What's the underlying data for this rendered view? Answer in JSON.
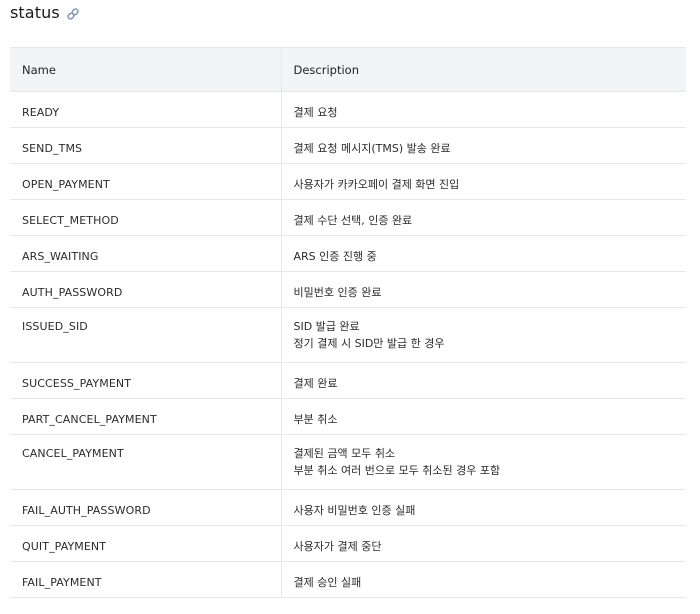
{
  "heading": {
    "title": "status"
  },
  "table": {
    "columns": [
      "Name",
      "Description"
    ],
    "rows": [
      {
        "name": "READY",
        "description": [
          "결제 요청"
        ]
      },
      {
        "name": "SEND_TMS",
        "description": [
          "결제 요청 메시지(TMS) 발송 완료"
        ]
      },
      {
        "name": "OPEN_PAYMENT",
        "description": [
          "사용자가 카카오페이 결제 화면 진입"
        ]
      },
      {
        "name": "SELECT_METHOD",
        "description": [
          "결제 수단 선택, 인증 완료"
        ]
      },
      {
        "name": "ARS_WAITING",
        "description": [
          "ARS 인증 진행 중"
        ]
      },
      {
        "name": "AUTH_PASSWORD",
        "description": [
          "비밀번호 인증 완료"
        ]
      },
      {
        "name": "ISSUED_SID",
        "description": [
          "SID 발급 완료",
          "정기 결제 시 SID만 발급 한 경우"
        ]
      },
      {
        "name": "SUCCESS_PAYMENT",
        "description": [
          "결제 완료"
        ]
      },
      {
        "name": "PART_CANCEL_PAYMENT",
        "description": [
          "부분 취소"
        ]
      },
      {
        "name": "CANCEL_PAYMENT",
        "description": [
          "결제된 금액 모두 취소",
          "부분 취소 여러 번으로 모두 취소된 경우 포함"
        ]
      },
      {
        "name": "FAIL_AUTH_PASSWORD",
        "description": [
          "사용자 비밀번호 인증 실패"
        ]
      },
      {
        "name": "QUIT_PAYMENT",
        "description": [
          "사용자가 결제 중단"
        ]
      },
      {
        "name": "FAIL_PAYMENT",
        "description": [
          "결제 승인 실패"
        ]
      }
    ]
  },
  "icons": {
    "heading_link": "link-icon"
  }
}
